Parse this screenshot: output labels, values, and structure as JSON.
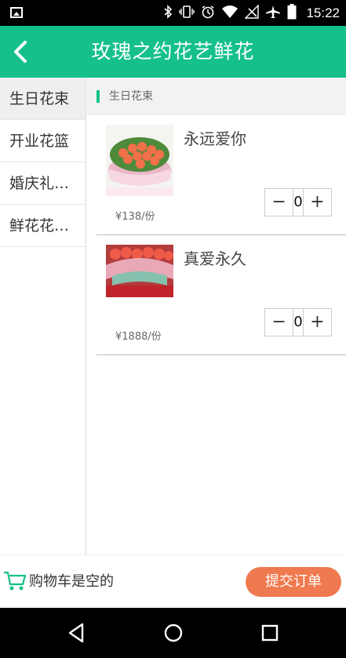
{
  "status_bar": {
    "time": "15:22",
    "icons": [
      "gallery-icon",
      "bluetooth-icon",
      "vibrate-icon",
      "alarm-icon",
      "wifi-icon",
      "no-signal-icon",
      "airplane-icon",
      "battery-icon"
    ]
  },
  "header": {
    "title": "玫瑰之约花艺鲜花",
    "accent_color": "#15c08b"
  },
  "sidebar": {
    "items": [
      {
        "label": "生日花束",
        "active": true
      },
      {
        "label": "开业花篮",
        "active": false
      },
      {
        "label": "婚庆礼…",
        "active": false
      },
      {
        "label": "鲜花花…",
        "active": false
      }
    ]
  },
  "main": {
    "section_title": "生日花束",
    "products": [
      {
        "name": "永远爱你",
        "price": "¥138/份",
        "quantity": "0",
        "decrement": "−",
        "increment": "+"
      },
      {
        "name": "真爱永久",
        "price": "¥1888/份",
        "quantity": "0",
        "decrement": "−",
        "increment": "+"
      }
    ]
  },
  "footer": {
    "cart_status": "购物车是空的",
    "submit_label": "提交订单",
    "submit_color": "#f07a50"
  }
}
